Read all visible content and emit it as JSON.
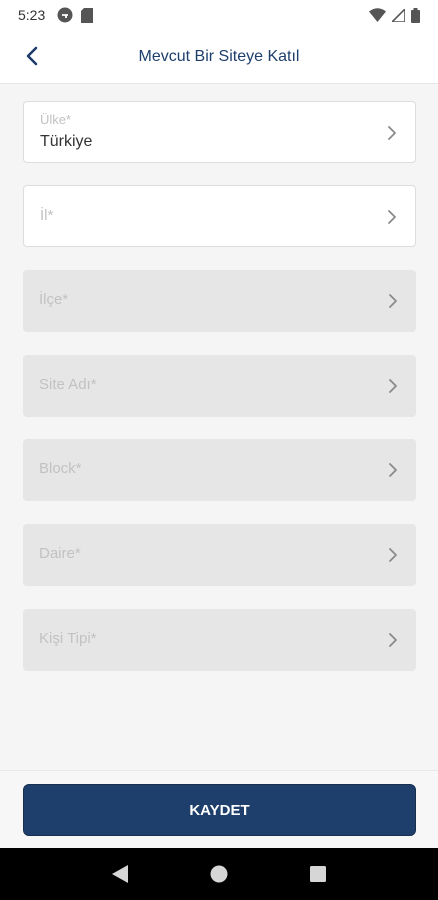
{
  "status_bar": {
    "time": "5:23",
    "left_icons": [
      "vpn-key-icon",
      "sd-card-icon"
    ],
    "right_icons": [
      "wifi-icon",
      "cell-signal-icon",
      "battery-icon"
    ]
  },
  "header": {
    "title": "Mevcut Bir Siteye Katıl",
    "back_icon": "chevron-left-icon"
  },
  "fields": [
    {
      "label": "Ülke*",
      "value": "Türkiye",
      "enabled": true
    },
    {
      "label": "İl*",
      "value": "",
      "enabled": true
    },
    {
      "label": "İlçe*",
      "value": "",
      "enabled": false
    },
    {
      "label": "Site Adı*",
      "value": "",
      "enabled": false
    },
    {
      "label": "Block*",
      "value": "",
      "enabled": false
    },
    {
      "label": "Daire*",
      "value": "",
      "enabled": false
    },
    {
      "label": "Kişi Tipi*",
      "value": "",
      "enabled": false
    }
  ],
  "save_button": {
    "label": "KAYDET"
  },
  "colors": {
    "primary": "#1e3e6b",
    "disabled_field": "#e6e6e6",
    "enabled_field": "#ffffff",
    "label": "#c2c2c2",
    "value_text": "#333333"
  },
  "nav_bar": {
    "icons": [
      "back-triangle-icon",
      "home-circle-icon",
      "recents-square-icon"
    ]
  }
}
